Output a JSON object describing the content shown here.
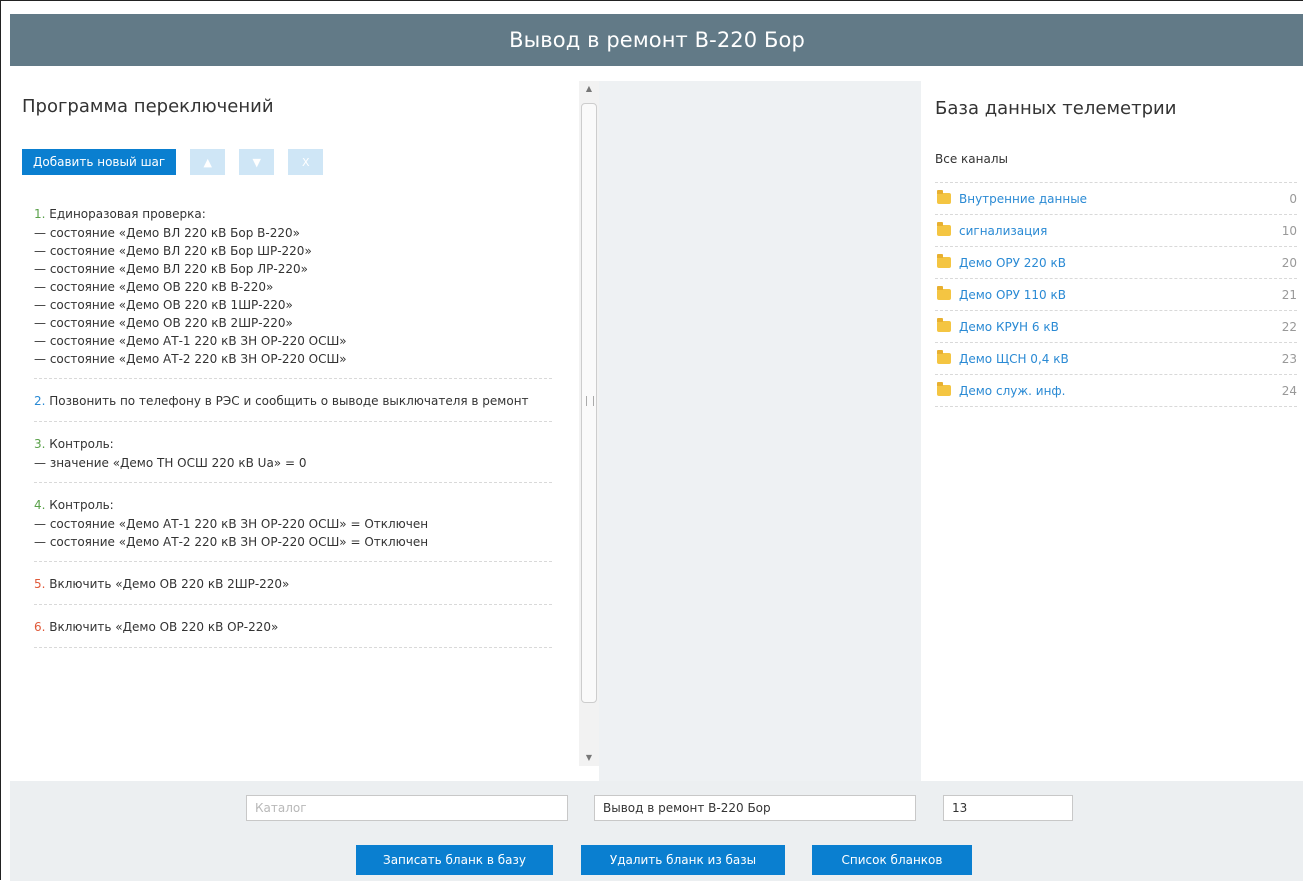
{
  "window": {
    "title": "Вывод в ремонт В-220 Бор"
  },
  "program": {
    "heading": "Программа переключений",
    "add_step_label": "Добавить новый шаг",
    "up_label": "▲",
    "down_label": "▼",
    "delete_label": "X",
    "steps": [
      {
        "num": "1.",
        "color": "#5aa14a",
        "text": "Единоразовая проверка:",
        "lines": [
          "— состояние «Демо ВЛ 220 кВ Бор В-220»",
          "— состояние «Демо ВЛ 220 кВ Бор ШР-220»",
          "— состояние «Демо ВЛ 220 кВ Бор ЛР-220»",
          "— состояние «Демо ОВ 220 кВ В-220»",
          "— состояние «Демо ОВ 220 кВ 1ШР-220»",
          "— состояние «Демо ОВ 220 кВ 2ШР-220»",
          "— состояние «Демо АТ-1 220 кВ ЗН ОР-220 ОСШ»",
          "— состояние «Демо АТ-2 220 кВ ЗН ОР-220 ОСШ»"
        ]
      },
      {
        "num": "2.",
        "color": "#2a8ad4",
        "text": "Позвонить по телефону в РЭС и сообщить о выводе выключателя в ремонт",
        "lines": []
      },
      {
        "num": "3.",
        "color": "#5aa14a",
        "text": "Контроль:",
        "lines": [
          "— значение «Демо ТН ОСШ 220 кВ Ua» = 0"
        ]
      },
      {
        "num": "4.",
        "color": "#5aa14a",
        "text": "Контроль:",
        "lines": [
          "— состояние «Демо АТ-1 220 кВ ЗН ОР-220 ОСШ» = Отключен",
          "— состояние «Демо АТ-2 220 кВ ЗН ОР-220 ОСШ» = Отключен"
        ]
      },
      {
        "num": "5.",
        "color": "#e05a3a",
        "text": "Включить «Демо ОВ 220 кВ 2ШР-220»",
        "lines": []
      },
      {
        "num": "6.",
        "color": "#e05a3a",
        "text": "Включить «Демо ОВ 220 кВ ОР-220»",
        "lines": []
      }
    ]
  },
  "telemetry": {
    "heading": "База данных телеметрии",
    "all_channels": "Все каналы",
    "channels": [
      {
        "name": "Внутренние данные",
        "count": "0"
      },
      {
        "name": "сигнализация",
        "count": "10"
      },
      {
        "name": "Демо ОРУ 220 кВ",
        "count": "20"
      },
      {
        "name": "Демо ОРУ 110 кВ",
        "count": "21"
      },
      {
        "name": "Демо КРУН 6 кВ",
        "count": "22"
      },
      {
        "name": "Демо ЩСН 0,4 кВ",
        "count": "23"
      },
      {
        "name": "Демо служ. инф.",
        "count": "24"
      }
    ]
  },
  "form": {
    "catalog_placeholder": "Каталог",
    "name_value": "Вывод в ремонт В-220 Бор",
    "number_value": "13"
  },
  "actions": {
    "save_label": "Записать бланк в базу",
    "delete_label": "Удалить бланк из базы",
    "list_label": "Список бланков"
  }
}
